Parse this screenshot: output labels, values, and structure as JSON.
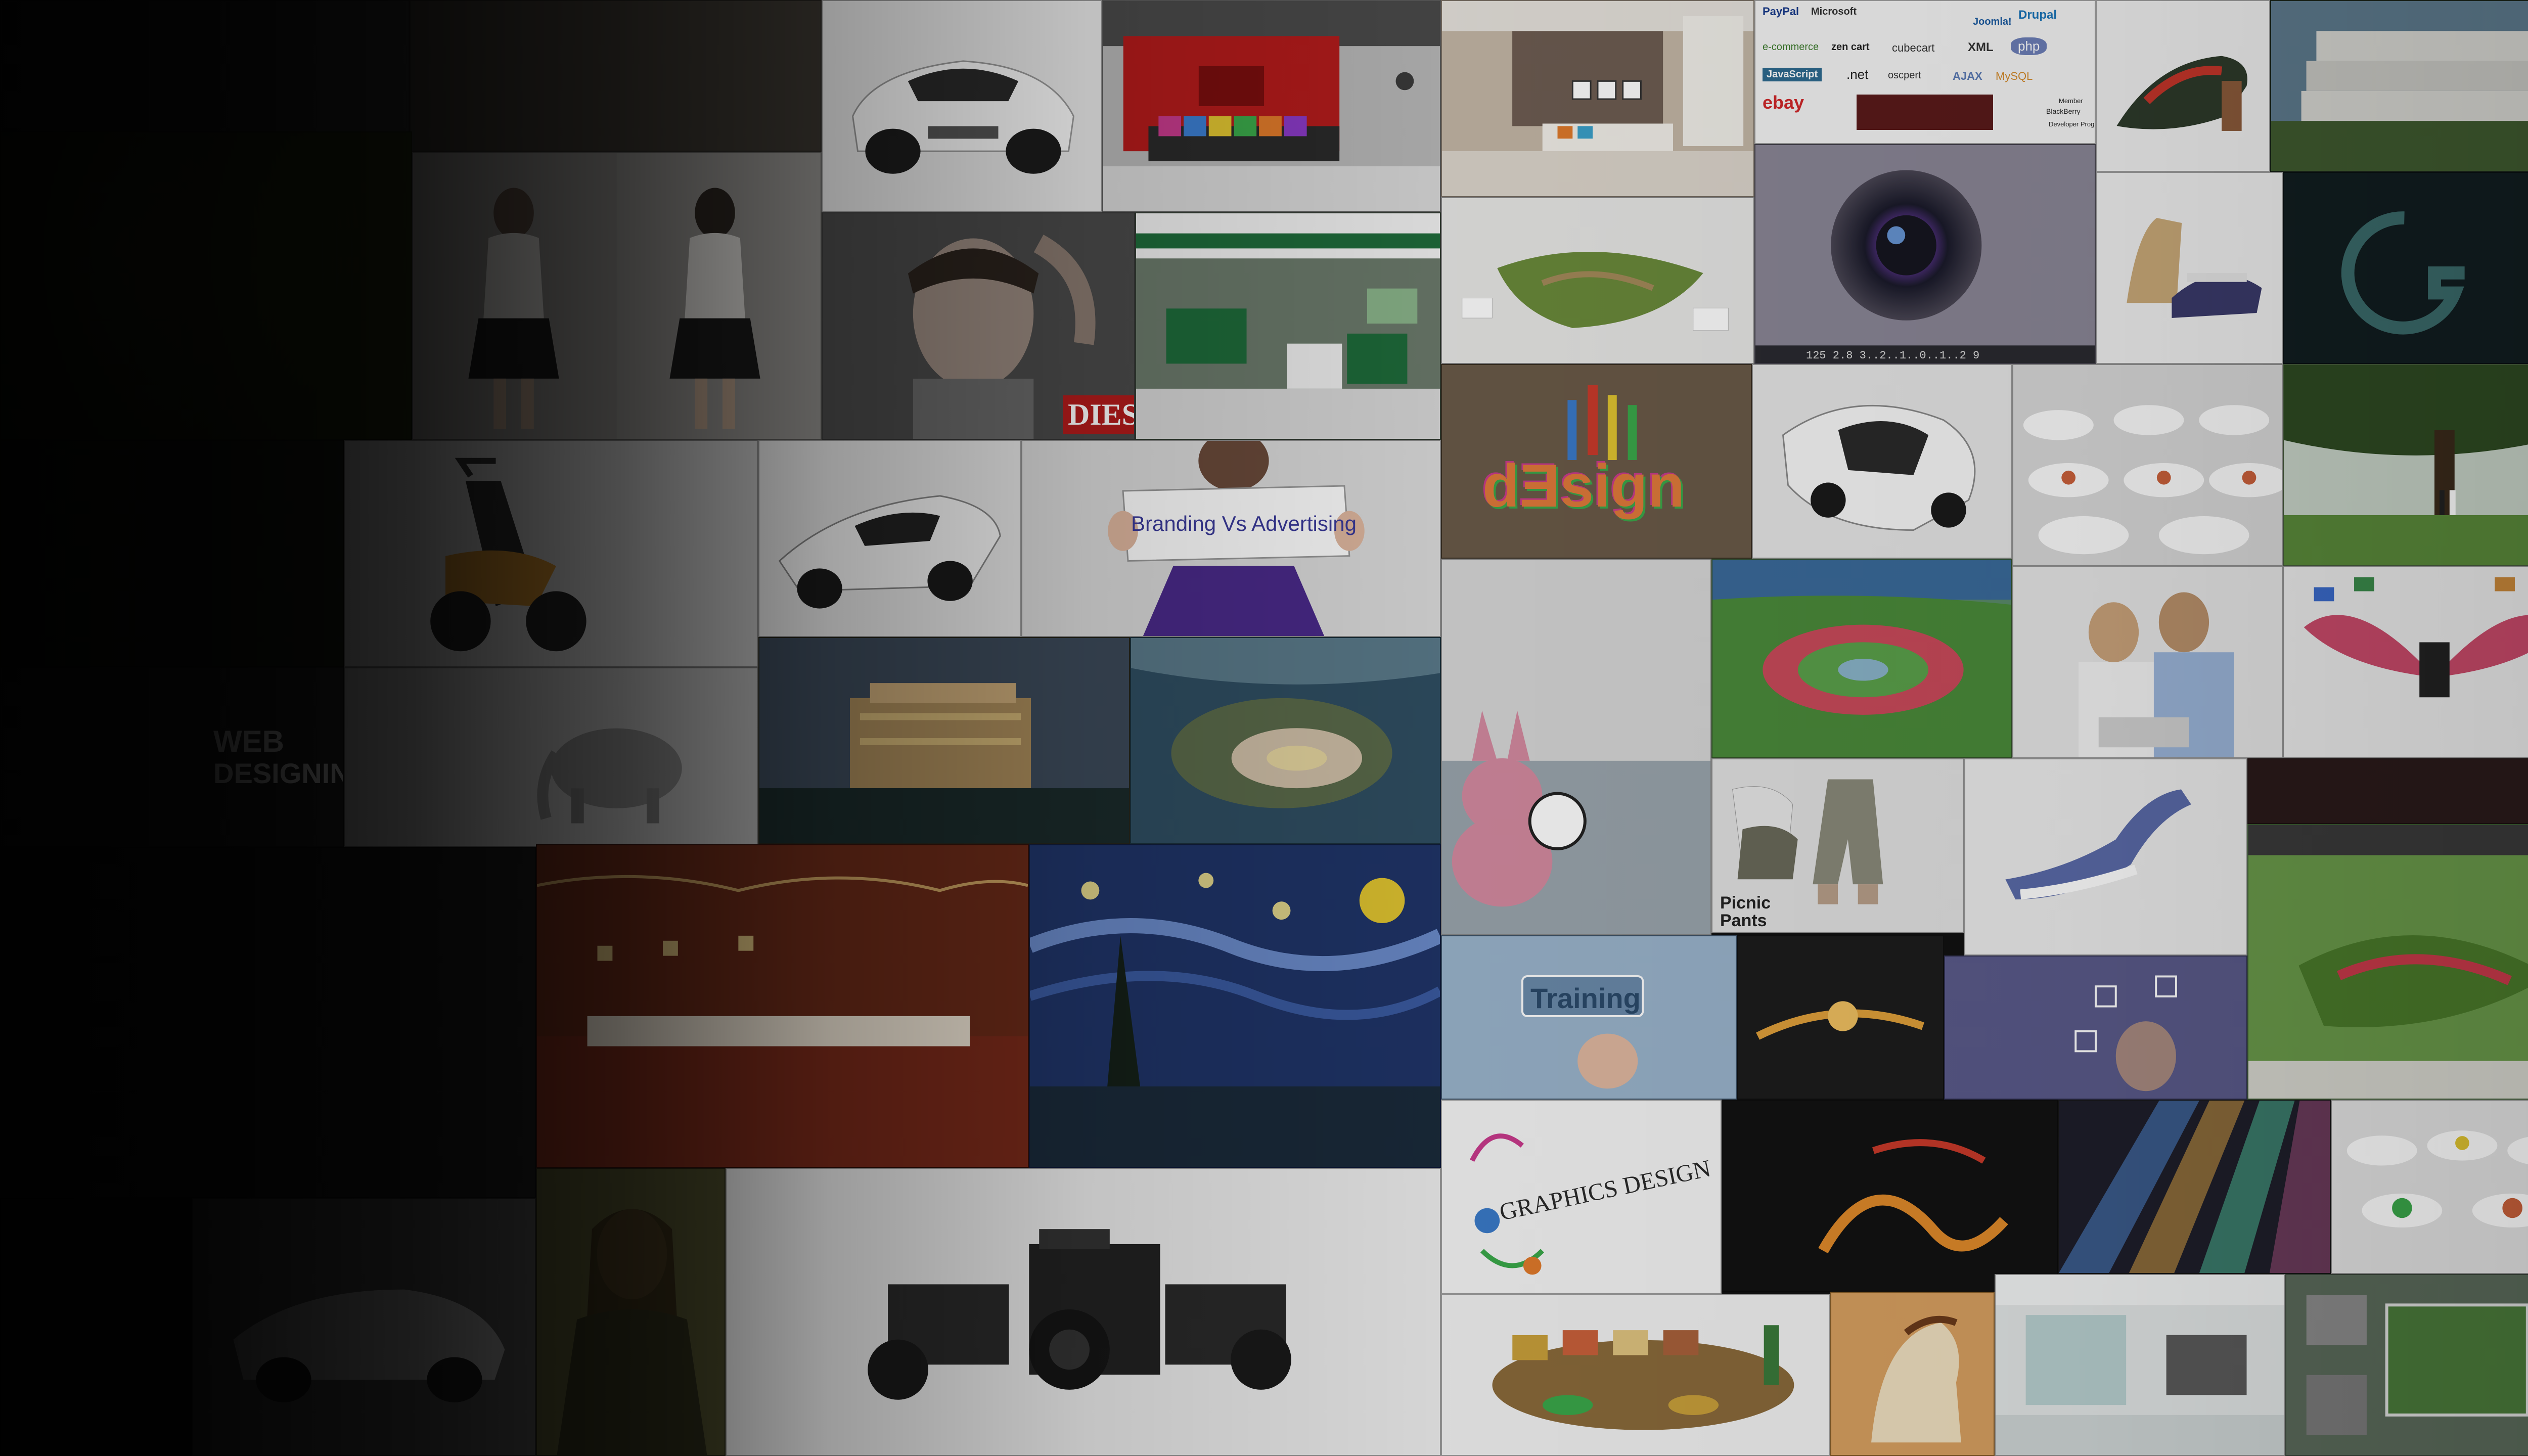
{
  "collage": {
    "texts": {
      "diesel": "DIESEL",
      "branding": "Branding Vs Advertising",
      "design": "dƎsign",
      "web_designing_1": "WEB",
      "web_designing_2": "DESIGNING",
      "picnic_1": "Picnic",
      "picnic_2": "Pants",
      "training": "Training",
      "graphics_design": "GRAPHICS DESIGN",
      "tech_paypal": "PayPal",
      "tech_microsoft": "Microsoft",
      "tech_joomla": "Joomla!",
      "tech_drupal": "Drupal",
      "tech_commerce": "e-commerce",
      "tech_zencart": "zen cart",
      "tech_cubecart": "cubecart",
      "tech_xml": "XML",
      "tech_php": "php",
      "tech_javascript": "JavaScript",
      "tech_net": ".net",
      "tech_oscpert": "oscpert",
      "tech_ajax": "AJAX",
      "tech_mysql": "MySQL",
      "tech_ebay": "ebay",
      "tech_blackberry": "BlackBerry",
      "tech_member": "Member",
      "tech_developer": "Developer Program",
      "camera_readout": "125  2.8  3..2..1..0..1..2  9"
    }
  }
}
